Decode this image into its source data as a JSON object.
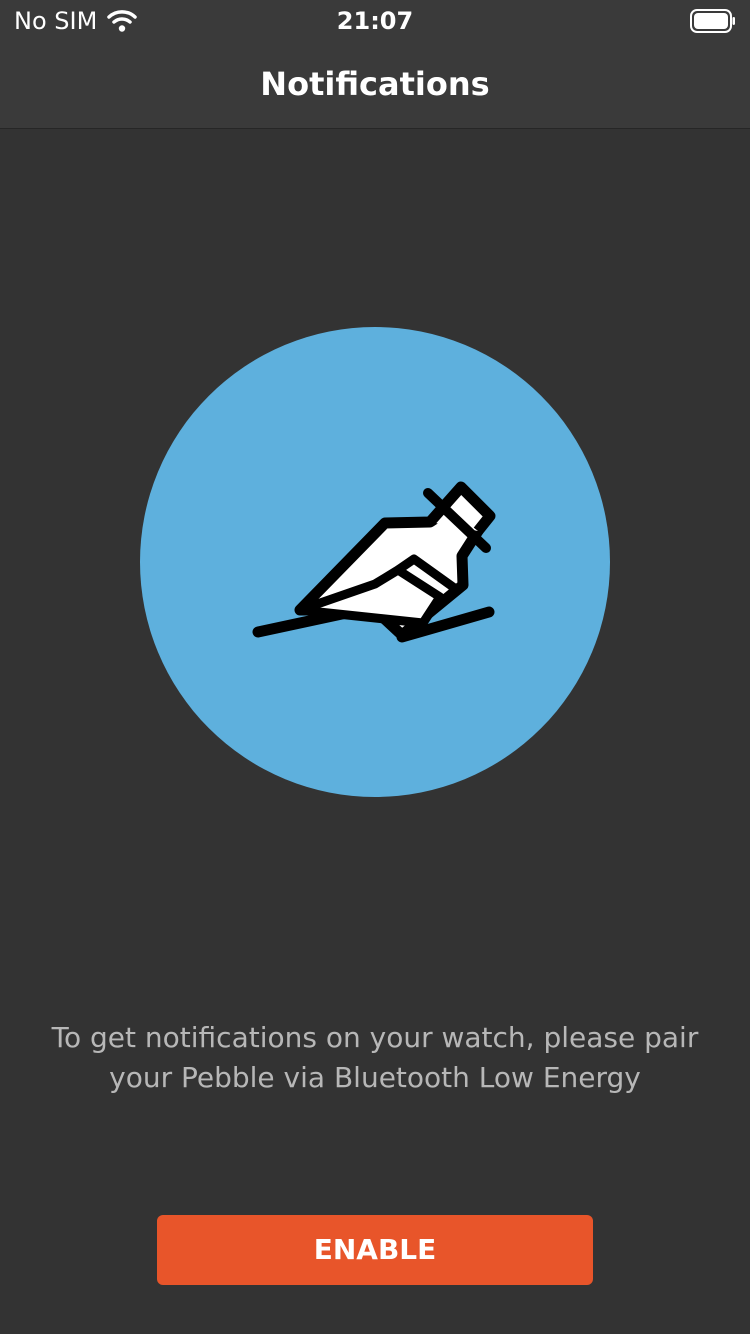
{
  "status_bar": {
    "carrier": "No SIM",
    "time": "21:07",
    "wifi_icon": "wifi-icon",
    "battery_icon": "battery-icon"
  },
  "nav": {
    "title": "Notifications"
  },
  "hero": {
    "icon": "message-in-bottle-icon",
    "circle_color": "#5eb0dd"
  },
  "content": {
    "message": "To get notifications on your watch, please pair your Pebble via Bluetooth Low Energy"
  },
  "actions": {
    "enable_label": "ENABLE",
    "enable_color": "#e8552a"
  },
  "colors": {
    "background": "#333333",
    "bar": "#3a3a3a",
    "message_text": "#b7b7b7"
  }
}
